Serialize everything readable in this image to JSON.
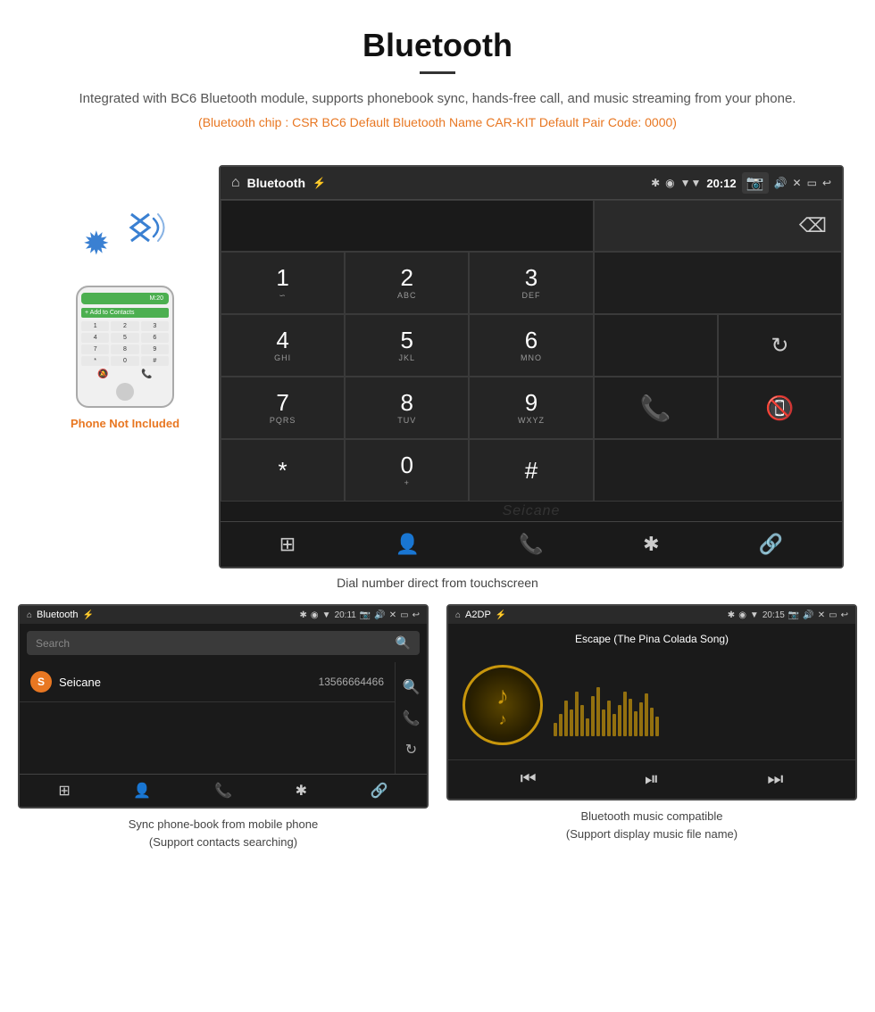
{
  "header": {
    "title": "Bluetooth",
    "description": "Integrated with BC6 Bluetooth module, supports phonebook sync, hands-free call, and music streaming from your phone.",
    "specs": "(Bluetooth chip : CSR BC6    Default Bluetooth Name CAR-KIT    Default Pair Code: 0000)"
  },
  "phone": {
    "not_included_label": "Phone Not Included"
  },
  "main_screen": {
    "status_bar": {
      "home_icon": "⌂",
      "title": "Bluetooth",
      "usb_icon": "⚡",
      "time": "20:12",
      "icons": [
        "✱",
        "◉",
        "▼",
        "📷",
        "🔊",
        "✕",
        "▭",
        "↩"
      ]
    },
    "dialpad": {
      "keys": [
        {
          "num": "1",
          "sub": "∞"
        },
        {
          "num": "2",
          "sub": "ABC"
        },
        {
          "num": "3",
          "sub": "DEF"
        },
        {
          "num": "4",
          "sub": "GHI"
        },
        {
          "num": "5",
          "sub": "JKL"
        },
        {
          "num": "6",
          "sub": "MNO"
        },
        {
          "num": "7",
          "sub": "PQRS"
        },
        {
          "num": "8",
          "sub": "TUV"
        },
        {
          "num": "9",
          "sub": "WXYZ"
        },
        {
          "num": "*",
          "sub": ""
        },
        {
          "num": "0",
          "sub": "+"
        },
        {
          "num": "#",
          "sub": ""
        }
      ]
    },
    "bottom_nav": {
      "icons": [
        "⊞",
        "👤",
        "📞",
        "✱",
        "🔗"
      ]
    },
    "watermark": "Seicane"
  },
  "main_caption": "Dial number direct from touchscreen",
  "bottom_left": {
    "status": {
      "home": "⌂",
      "title": "Bluetooth",
      "usb": "⚡",
      "time": "20:11",
      "icons": "✱ ◉ ▼"
    },
    "search_placeholder": "Search",
    "contact": {
      "initial": "S",
      "name": "Seicane",
      "number": "13566664466"
    },
    "bottom_nav_icons": [
      "⊞",
      "👤",
      "📞",
      "✱",
      "🔗"
    ],
    "caption_line1": "Sync phone-book from mobile phone",
    "caption_line2": "(Support contacts searching)"
  },
  "bottom_right": {
    "status": {
      "home": "⌂",
      "title": "A2DP",
      "usb": "⚡",
      "time": "20:15",
      "icons": "✱ ◉ ▼"
    },
    "song_title": "Escape (The Pina Colada Song)",
    "music_bars": [
      15,
      25,
      40,
      30,
      50,
      35,
      20,
      45,
      55,
      30,
      40,
      25,
      35,
      50,
      42,
      28,
      38,
      48,
      32,
      22
    ],
    "controls": [
      "⏮",
      "⏯",
      "⏭"
    ],
    "caption_line1": "Bluetooth music compatible",
    "caption_line2": "(Support display music file name)"
  }
}
